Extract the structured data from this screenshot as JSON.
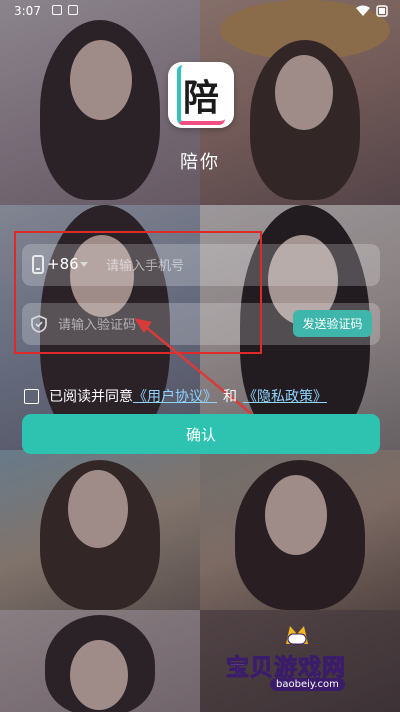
{
  "status_bar": {
    "time": "3:07"
  },
  "app": {
    "logo_char": "陪",
    "name": "陪你"
  },
  "phone": {
    "country_code": "+86",
    "placeholder": "请输入手机号"
  },
  "code": {
    "placeholder": "请输入验证码",
    "send_label": "发送验证码"
  },
  "agreement": {
    "prefix": "已阅读并同意",
    "user_agreement": "《用户协议》",
    "conjunction": "和",
    "privacy_policy": "《隐私政策》"
  },
  "confirm_label": "确认",
  "watermark": {
    "title": "宝贝游戏网",
    "url": "baobeiy.com"
  },
  "colors": {
    "accent": "#2ec2b0",
    "annotation": "#e02a2a",
    "link": "#8fd3ff"
  }
}
